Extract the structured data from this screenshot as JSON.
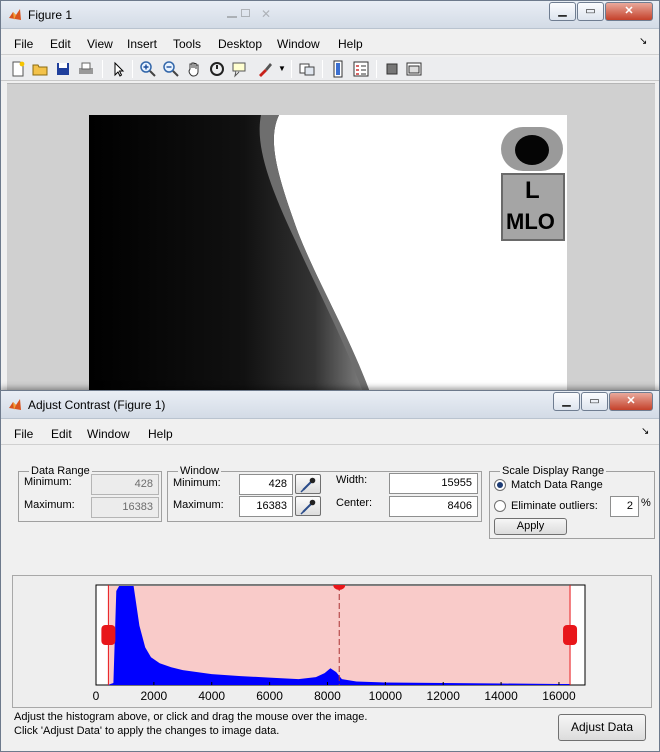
{
  "figure": {
    "title": "Figure 1",
    "menu": [
      "File",
      "Edit",
      "View",
      "Insert",
      "Tools",
      "Desktop",
      "Window",
      "Help"
    ],
    "toolbar": [
      "new-figure-icon",
      "open-file-icon",
      "save-icon",
      "print-icon",
      "pointer-icon",
      "zoom-in-icon",
      "zoom-out-icon",
      "pan-hand-icon",
      "rotate-3d-icon",
      "data-cursor-icon",
      "brush-icon",
      "link-plot-icon",
      "colorbar-icon",
      "legend-icon",
      "hide-plot-tools-icon",
      "show-plot-tools-icon"
    ],
    "image": {
      "marker_letter": "L",
      "marker_view": "MLO"
    }
  },
  "contrast": {
    "title": "Adjust Contrast (Figure 1)",
    "menu": [
      "File",
      "Edit",
      "Window",
      "Help"
    ],
    "data_range": {
      "title": "Data Range",
      "min_label": "Minimum:",
      "min_value": "428",
      "max_label": "Maximum:",
      "max_value": "16383"
    },
    "window": {
      "title": "Window",
      "min_label": "Minimum:",
      "min_value": "428",
      "max_label": "Maximum:",
      "max_value": "16383",
      "width_label": "Width:",
      "width_value": "15955",
      "center_label": "Center:",
      "center_value": "8406"
    },
    "scale": {
      "title": "Scale Display Range",
      "match_label": "Match Data Range",
      "eliminate_label": "Eliminate outliers:",
      "outliers_value": "2",
      "percent": "%",
      "apply_label": "Apply",
      "selected": "match"
    },
    "help_line1": "Adjust the histogram above, or click and drag the mouse over the image.",
    "help_line2": "Click 'Adjust Data' to apply the changes to image data.",
    "adjust_button": "Adjust Data"
  },
  "chart_data": {
    "type": "area",
    "x_ticks": [
      "0",
      "2000",
      "4000",
      "6000",
      "8000",
      "10000",
      "12000",
      "14000",
      "16000"
    ],
    "xlim": [
      0,
      16900
    ],
    "window_min": 428,
    "window_max": 16383,
    "window_center": 8406,
    "histogram": [
      [
        400,
        0
      ],
      [
        600,
        0.02
      ],
      [
        700,
        0.95
      ],
      [
        800,
        1.0
      ],
      [
        1300,
        1.0
      ],
      [
        1500,
        0.6
      ],
      [
        1700,
        0.38
      ],
      [
        1900,
        0.28
      ],
      [
        2200,
        0.22
      ],
      [
        2600,
        0.18
      ],
      [
        3000,
        0.15
      ],
      [
        3500,
        0.13
      ],
      [
        4000,
        0.11
      ],
      [
        5000,
        0.09
      ],
      [
        6000,
        0.075
      ],
      [
        7000,
        0.06
      ],
      [
        7600,
        0.08
      ],
      [
        7900,
        0.12
      ],
      [
        8100,
        0.17
      ],
      [
        8300,
        0.13
      ],
      [
        8500,
        0.06
      ],
      [
        9000,
        0.035
      ],
      [
        10000,
        0.025
      ],
      [
        12000,
        0.02
      ],
      [
        14000,
        0.015
      ],
      [
        16000,
        0.01
      ],
      [
        16380,
        0.01
      ],
      [
        16400,
        0
      ]
    ],
    "colors": {
      "histogram": "#0000ff",
      "window": "#f9cbc9",
      "handle": "#e8161a"
    }
  }
}
